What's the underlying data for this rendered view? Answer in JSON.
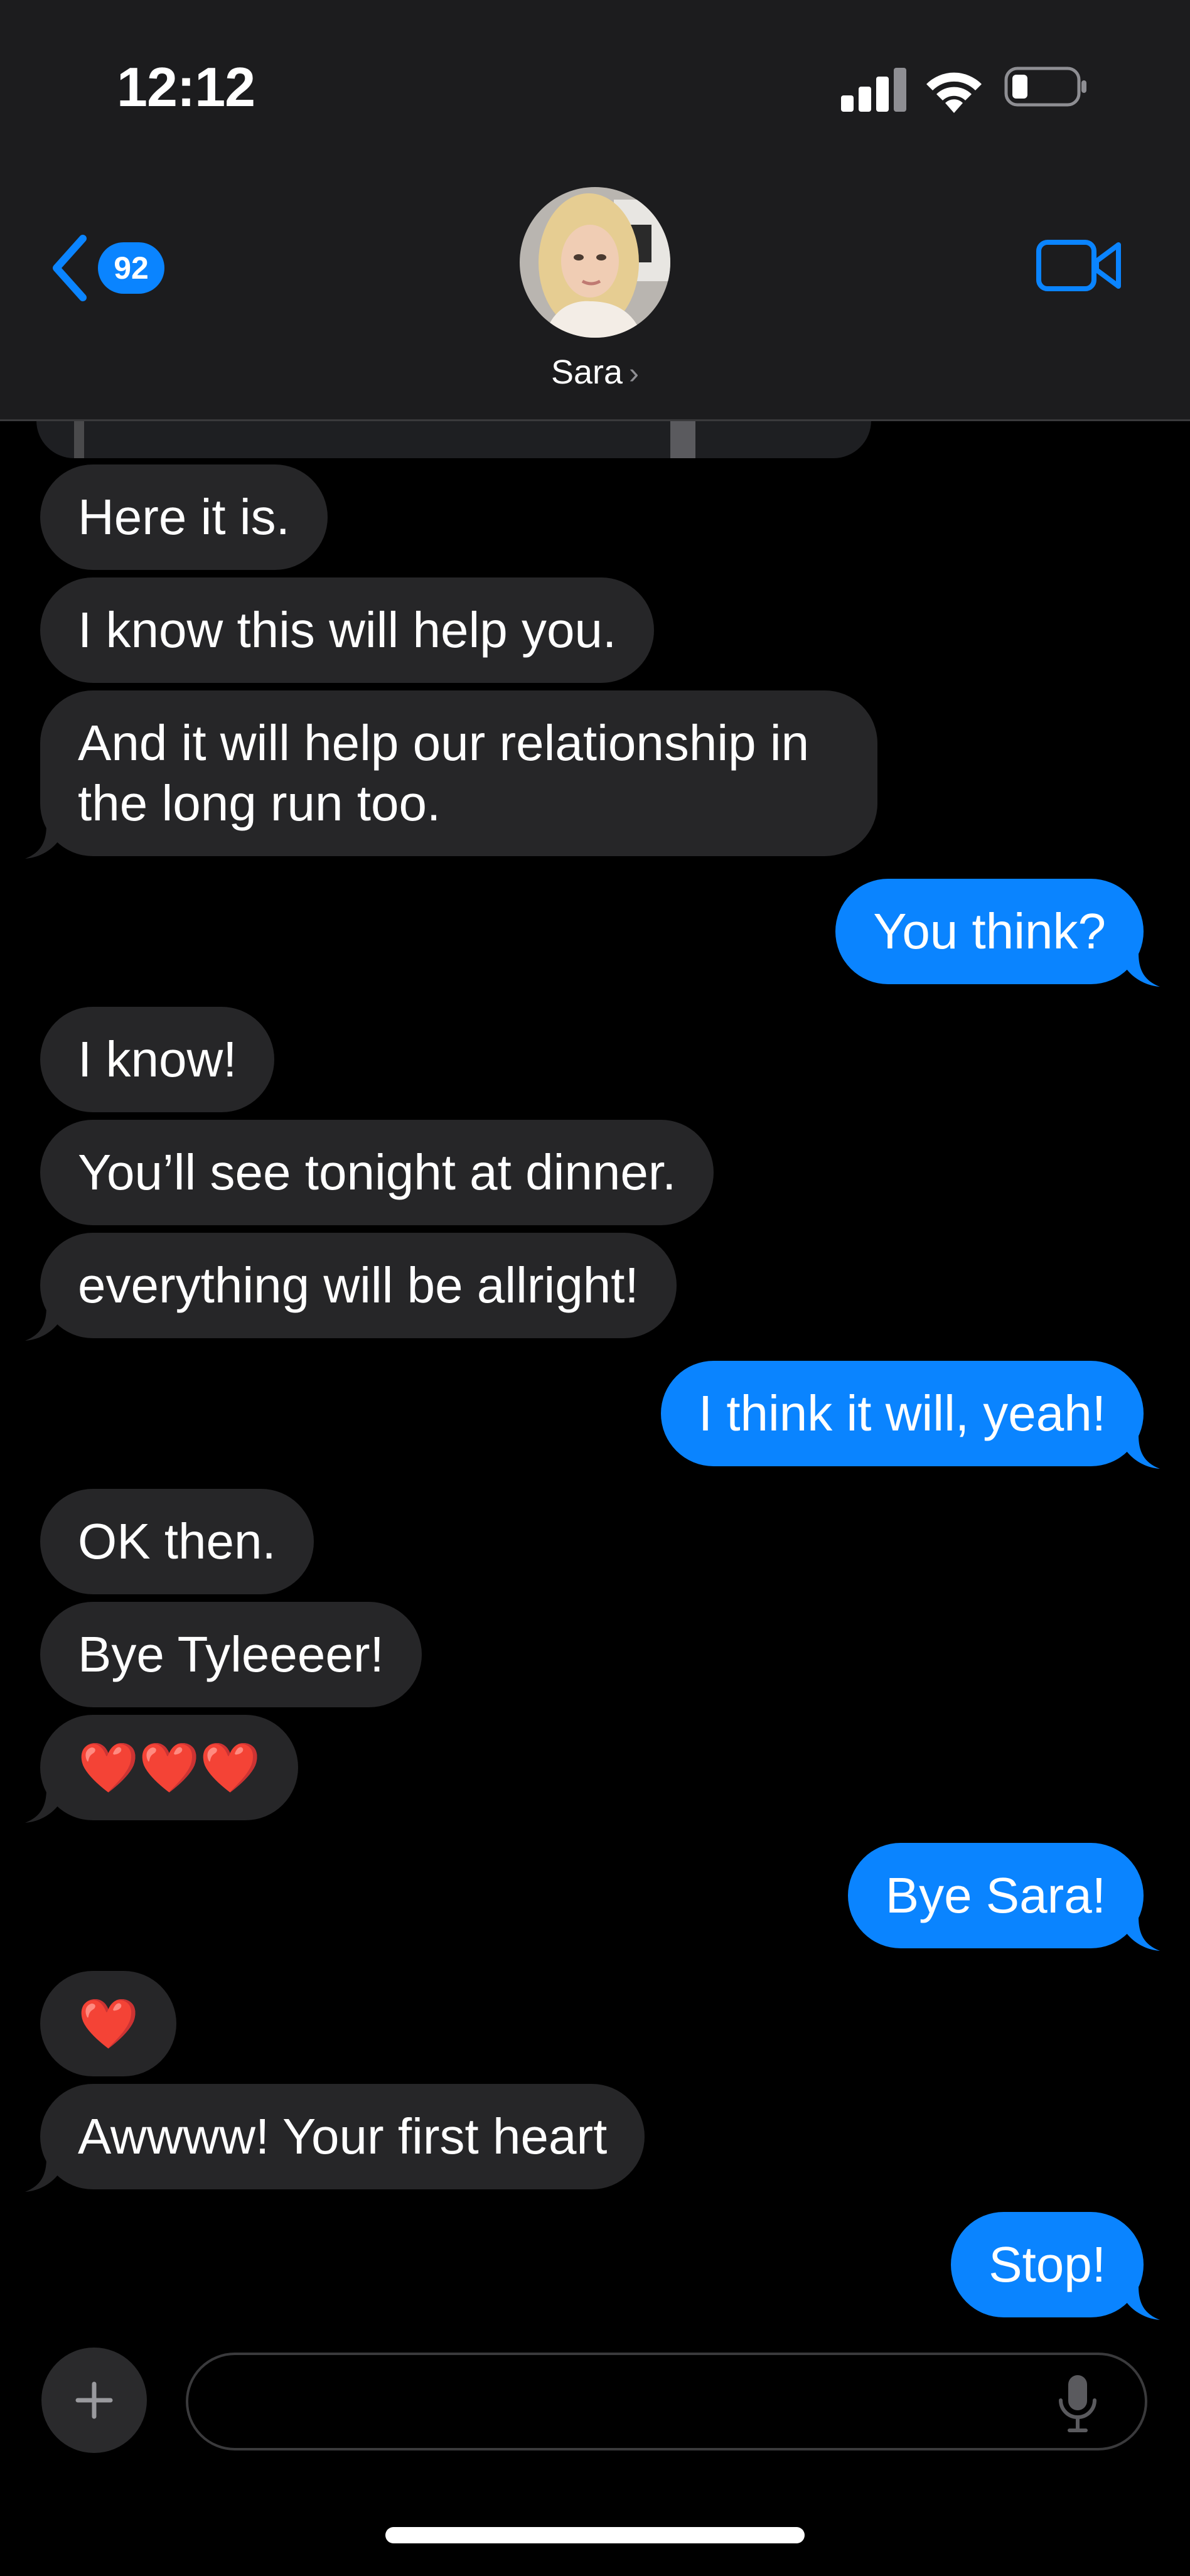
{
  "status_bar": {
    "time": "12:12"
  },
  "header": {
    "back_badge": "92",
    "contact_name": "Sara",
    "name_chevron": "›"
  },
  "messages": [
    {
      "from": "them",
      "text": "Here it is."
    },
    {
      "from": "them",
      "text": "I know this will help you."
    },
    {
      "from": "them",
      "text": "And it will help our relationship in the long run too."
    },
    {
      "from": "me",
      "text": "You think?"
    },
    {
      "from": "them",
      "text": "I know!"
    },
    {
      "from": "them",
      "text": "You’ll see tonight at dinner."
    },
    {
      "from": "them",
      "text": "everything will be allright!"
    },
    {
      "from": "me",
      "text": "I think it will, yeah!"
    },
    {
      "from": "them",
      "text": "OK then."
    },
    {
      "from": "them",
      "text": "Bye Tyleeeer!"
    },
    {
      "from": "them",
      "text": "❤️❤️❤️"
    },
    {
      "from": "me",
      "text": "Bye Sara!"
    },
    {
      "from": "them",
      "text": "❤️"
    },
    {
      "from": "them",
      "text": "Awwww! Your first heart"
    },
    {
      "from": "me",
      "text": "Stop!"
    }
  ],
  "composer": {
    "placeholder": "",
    "value": ""
  },
  "colors": {
    "accent": "#0a84ff",
    "incoming_bubble": "#262628",
    "header_bg": "#1c1c1e",
    "background": "#000000"
  },
  "icons": [
    "back-chevron-icon",
    "video-camera-icon",
    "signal-icon",
    "wifi-icon",
    "battery-icon",
    "plus-icon",
    "microphone-icon"
  ]
}
